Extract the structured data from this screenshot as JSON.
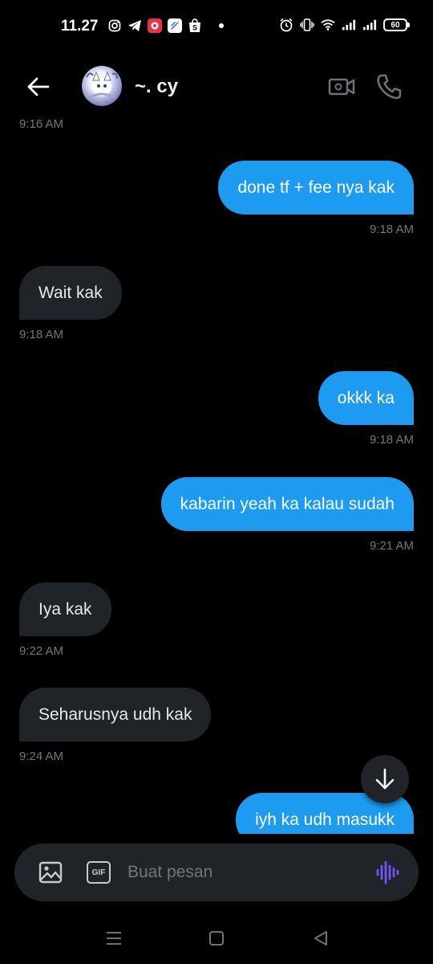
{
  "status_bar": {
    "time": "11.27",
    "battery": "60",
    "icons_left": [
      "instagram-icon",
      "telegram-icon",
      "app-red-icon",
      "app-blue-icon",
      "shopee-icon"
    ],
    "icons_right": [
      "alarm-icon",
      "vibrate-icon",
      "wifi-icon",
      "signal-icon",
      "signal-icon",
      "battery-icon"
    ]
  },
  "header": {
    "contact_name": "~. cy",
    "icons": [
      "back-arrow-icon",
      "video-call-icon",
      "phone-call-icon"
    ]
  },
  "messages": [
    {
      "direction": "meta",
      "time": "9:16 AM"
    },
    {
      "direction": "out",
      "text": "done tf + fee nya kak",
      "time": "9:18 AM"
    },
    {
      "direction": "in",
      "text": "Wait kak",
      "time": "9:18 AM"
    },
    {
      "direction": "out",
      "text": "okkk ka",
      "time": "9:18 AM"
    },
    {
      "direction": "out",
      "text": "kabarin yeah ka kalau sudah",
      "time": "9:21 AM"
    },
    {
      "direction": "in",
      "text": "Iya kak",
      "time": "9:22 AM"
    },
    {
      "direction": "in",
      "text": "Seharusnya udh kak",
      "time": "9:24 AM"
    },
    {
      "direction": "out",
      "text": "iyh ka udh masukk",
      "time": ""
    }
  ],
  "composer": {
    "placeholder": "Buat pesan",
    "value": "",
    "gif_label": "GIF",
    "voice_color": "#7856ff"
  },
  "colors": {
    "background": "#000000",
    "outgoing_bubble": "#1d9bf0",
    "incoming_bubble": "#202327",
    "timestamp": "#71767b"
  }
}
